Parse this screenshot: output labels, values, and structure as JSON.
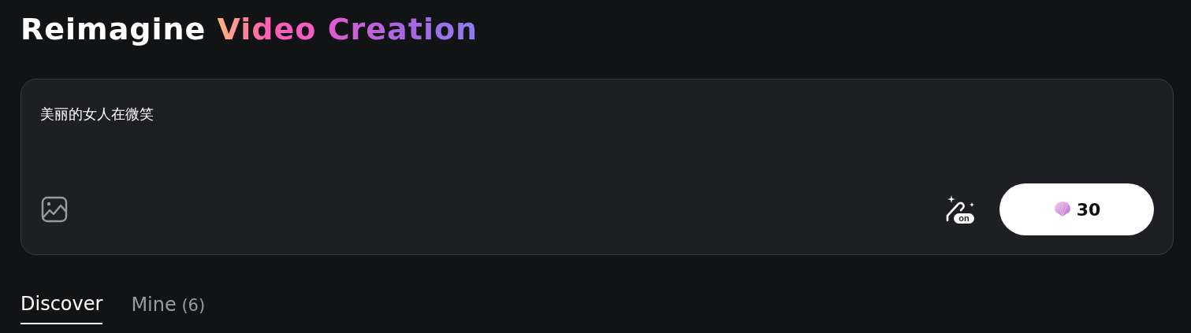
{
  "heading": {
    "words": [
      {
        "text": "Reimagine",
        "kind": "plain"
      },
      {
        "text": "Video",
        "kind": "gradient"
      },
      {
        "text": "Creation",
        "kind": "gradient"
      }
    ]
  },
  "prompt": {
    "value": "美丽的女人在微笑",
    "enhance": {
      "on": true,
      "badge": "on"
    },
    "generate_button": {
      "cost": "30"
    }
  },
  "tabs": [
    {
      "label": "Discover",
      "selected": true
    },
    {
      "label": "Mine",
      "count": "(6)",
      "selected": false
    }
  ]
}
